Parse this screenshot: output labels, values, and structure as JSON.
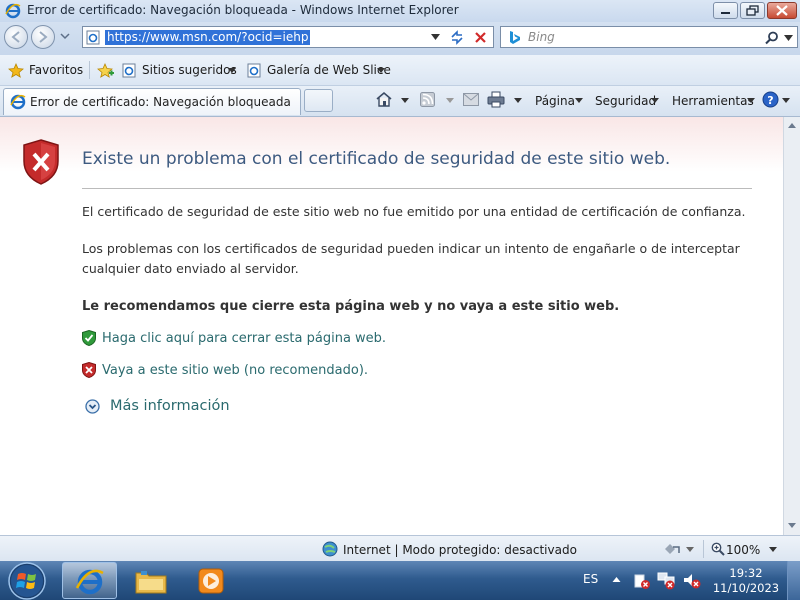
{
  "window": {
    "title": "Error de certificado: Navegación bloqueada - Windows Internet Explorer"
  },
  "address": {
    "url": "https://www.msn.com/?ocid=iehp"
  },
  "search": {
    "placeholder": "Bing"
  },
  "favorites_bar": {
    "favorites_label": "Favoritos",
    "suggested_label": "Sitios sugeridos",
    "webslice_label": "Galería de Web Slice"
  },
  "tab": {
    "title": "Error de certificado: Navegación bloqueada"
  },
  "command_bar": {
    "page_label": "Página",
    "safety_label": "Seguridad",
    "tools_label": "Herramientas"
  },
  "page": {
    "headline": "Existe un problema con el certificado de seguridad de este sitio web.",
    "para1": "El certificado de seguridad de este sitio web no fue emitido por una entidad de certificación de confianza.",
    "para2_line1": "Los problemas con los certificados de seguridad pueden indicar un intento de engañarle o de interceptar",
    "para2_line2": "cualquier dato enviado al servidor.",
    "recommendation": "Le recomendamos que cierre esta página web y no vaya a este sitio web.",
    "close_link": "Haga clic aquí para cerrar esta página web.",
    "continue_link": "Vaya a este sitio web (no recomendado).",
    "more_info": "Más información"
  },
  "status": {
    "zone_text": "Internet | Modo protegido: desactivado",
    "zoom": "100%"
  },
  "taskbar": {
    "language": "ES",
    "time": "19:32",
    "date": "11/10/2023"
  },
  "colors": {
    "link": "#2a6a6e",
    "headline": "#3d5a80",
    "shield_red": "#c42b2b",
    "shield_green": "#2f9a3a",
    "taskbar": "#2f5b8e"
  }
}
